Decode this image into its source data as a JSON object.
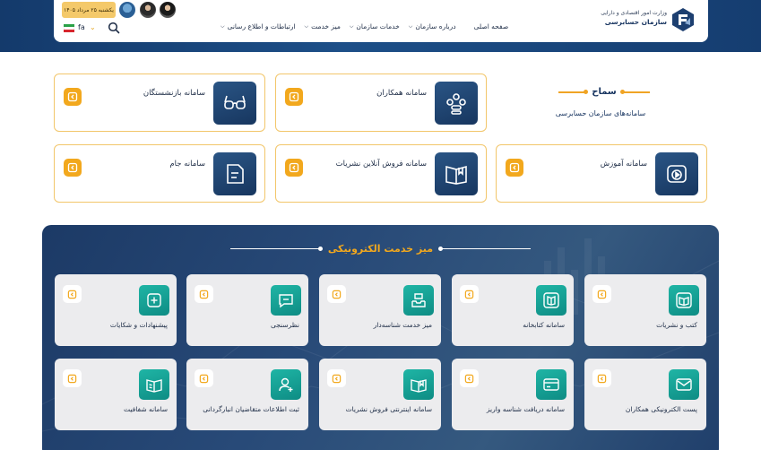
{
  "header": {
    "date": "یکشنبه ۲۵ مرداد ۱۴۰۵",
    "language": "fa",
    "logo_line1": "وزارت امور اقتصادی و دارایی",
    "logo_line2": "سازمان حسابرسی",
    "nav": [
      {
        "label": "صفحه اصلی",
        "has_menu": false
      },
      {
        "label": "درباره سازمان",
        "has_menu": true
      },
      {
        "label": "خدمات سازمان",
        "has_menu": true
      },
      {
        "label": "میز خدمت",
        "has_menu": true
      },
      {
        "label": "ارتباطات و اطلاع رسانی",
        "has_menu": true
      }
    ]
  },
  "samah": {
    "title": "سماح",
    "subtitle": "سامانه‌های سازمان حسابرسی"
  },
  "systems": [
    {
      "label": "سامانه همکاران",
      "icon": "team-icon"
    },
    {
      "label": "سامانه بازنشستگان",
      "icon": "glasses-icon"
    },
    {
      "label": "سامانه آموزش",
      "icon": "video-play-icon"
    },
    {
      "label": "سامانه فروش آنلاین نشریات",
      "icon": "book-icon"
    },
    {
      "label": "سامانه جام",
      "icon": "document-icon"
    }
  ],
  "desk": {
    "title": "میز خدمت الکترونیکی",
    "tiles": [
      {
        "label": "کتب و نشریات",
        "icon": "open-book-icon"
      },
      {
        "label": "سامانه کتابخانه",
        "icon": "library-icon"
      },
      {
        "label": "میز خدمت شناسه‌دار",
        "icon": "inbox-icon"
      },
      {
        "label": "نظرسنجی",
        "icon": "chat-icon"
      },
      {
        "label": "پیشنهادات و شکایات",
        "icon": "plus-icon"
      },
      {
        "label": "پست الکترونیکی همکاران",
        "icon": "mail-icon"
      },
      {
        "label": "سامانه دریافت شناسه واریز",
        "icon": "card-icon"
      },
      {
        "label": "سامانه اینترنتی فروش نشریات",
        "icon": "bookmark-book-icon"
      },
      {
        "label": "ثبت اطلاعات متقاضیان انبارگردانی",
        "icon": "user-add-icon"
      },
      {
        "label": "سامانه شفافیت",
        "icon": "transparency-book-icon"
      }
    ]
  },
  "colors": {
    "navy": "#16335f",
    "accent": "#f2a81d",
    "teal": "#14a396"
  }
}
